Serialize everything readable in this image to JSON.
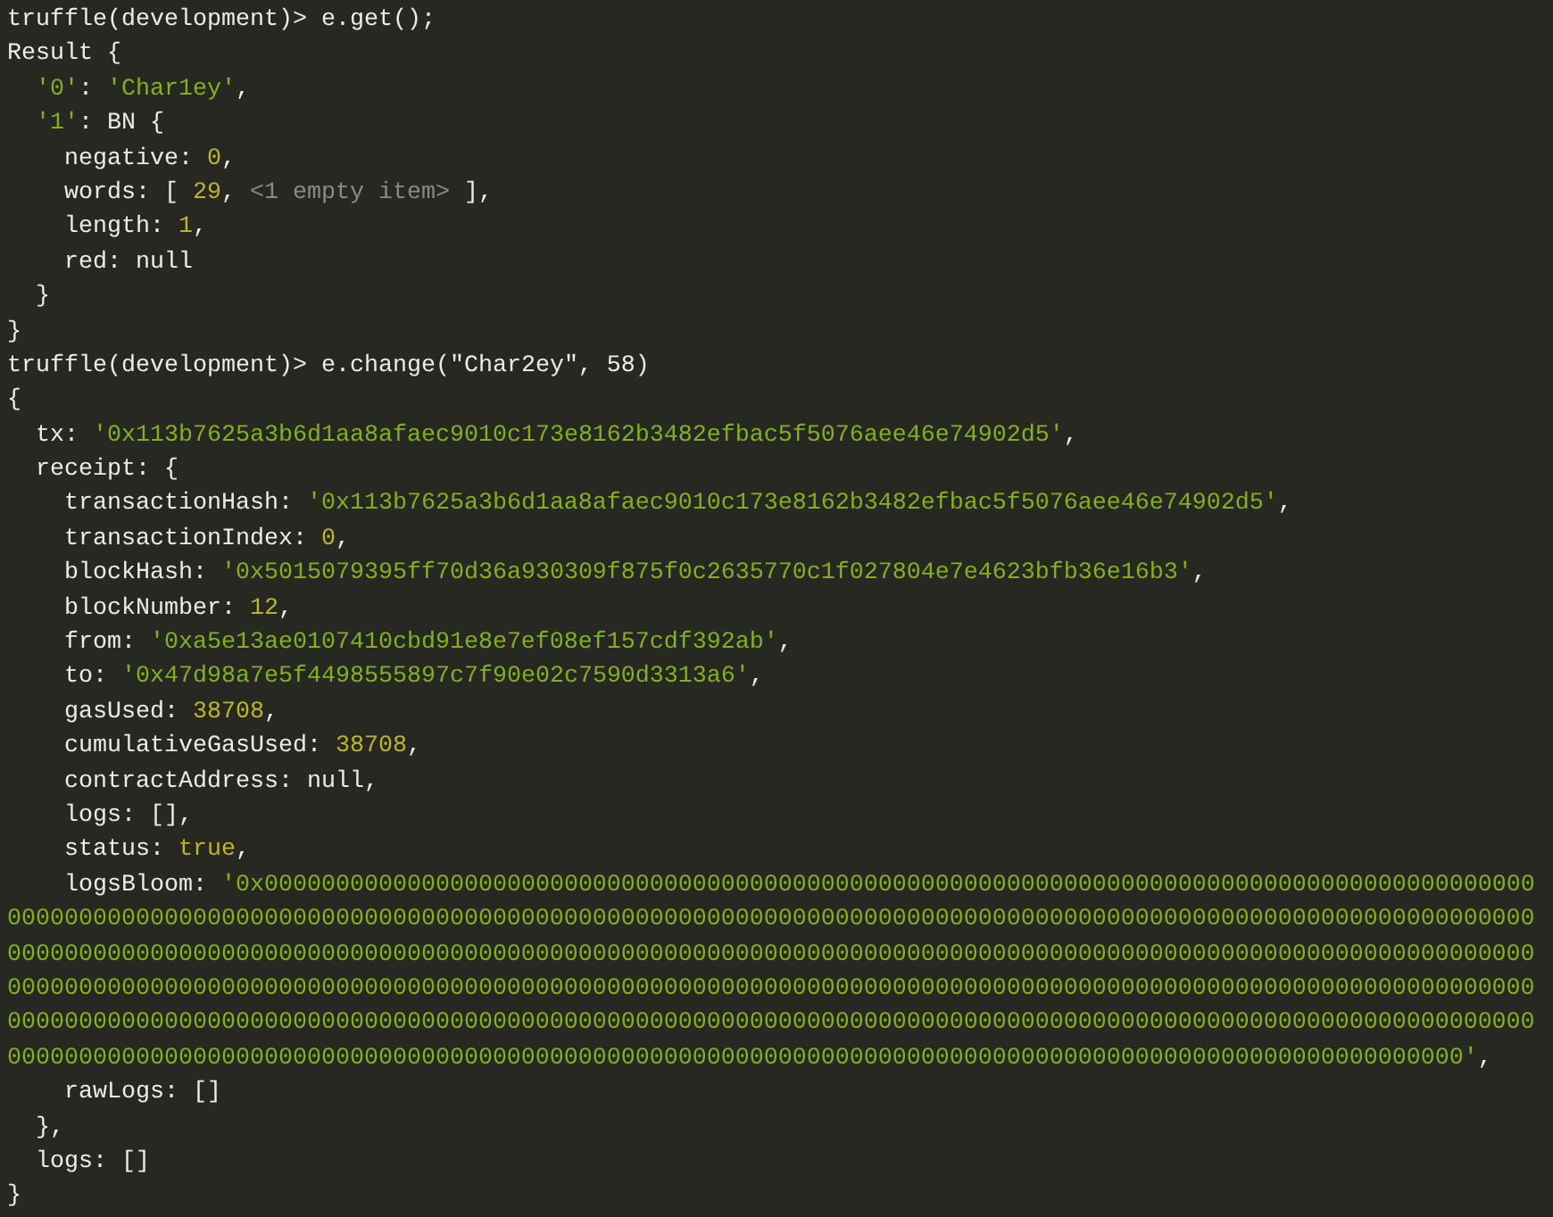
{
  "console_lines": [
    {
      "segments": [
        {
          "kind": "prompt",
          "text": "truffle(development)> "
        },
        {
          "kind": "plain",
          "text": "e.get();"
        }
      ]
    },
    {
      "segments": [
        {
          "kind": "plain",
          "text": "Result {"
        }
      ]
    },
    {
      "segments": [
        {
          "kind": "string",
          "text": "  '0'"
        },
        {
          "kind": "plain",
          "text": ": "
        },
        {
          "kind": "string",
          "text": "'Char1ey'"
        },
        {
          "kind": "plain",
          "text": ","
        }
      ]
    },
    {
      "segments": [
        {
          "kind": "string",
          "text": "  '1'"
        },
        {
          "kind": "plain",
          "text": ": BN {"
        }
      ]
    },
    {
      "segments": [
        {
          "kind": "plain",
          "text": "    negative: "
        },
        {
          "kind": "number",
          "text": "0"
        },
        {
          "kind": "plain",
          "text": ","
        }
      ]
    },
    {
      "segments": [
        {
          "kind": "plain",
          "text": "    words: [ "
        },
        {
          "kind": "number",
          "text": "29"
        },
        {
          "kind": "plain",
          "text": ", "
        },
        {
          "kind": "dim",
          "text": "<1 empty item>"
        },
        {
          "kind": "plain",
          "text": " ],"
        }
      ]
    },
    {
      "segments": [
        {
          "kind": "plain",
          "text": "    length: "
        },
        {
          "kind": "number",
          "text": "1"
        },
        {
          "kind": "plain",
          "text": ","
        }
      ]
    },
    {
      "segments": [
        {
          "kind": "plain",
          "text": "    red: null"
        }
      ]
    },
    {
      "segments": [
        {
          "kind": "plain",
          "text": "  }"
        }
      ]
    },
    {
      "segments": [
        {
          "kind": "plain",
          "text": "}"
        }
      ]
    },
    {
      "segments": [
        {
          "kind": "prompt",
          "text": "truffle(development)> "
        },
        {
          "kind": "plain",
          "text": "e.change(\"Char2ey\", 58)"
        }
      ]
    },
    {
      "segments": [
        {
          "kind": "plain",
          "text": "{"
        }
      ]
    },
    {
      "segments": [
        {
          "kind": "plain",
          "text": "  tx: "
        },
        {
          "kind": "string",
          "text": "'0x113b7625a3b6d1aa8afaec9010c173e8162b3482efbac5f5076aee46e74902d5'"
        },
        {
          "kind": "plain",
          "text": ","
        }
      ]
    },
    {
      "segments": [
        {
          "kind": "plain",
          "text": "  receipt: {"
        }
      ]
    },
    {
      "segments": [
        {
          "kind": "plain",
          "text": "    transactionHash: "
        },
        {
          "kind": "string",
          "text": "'0x113b7625a3b6d1aa8afaec9010c173e8162b3482efbac5f5076aee46e74902d5'"
        },
        {
          "kind": "plain",
          "text": ","
        }
      ]
    },
    {
      "segments": [
        {
          "kind": "plain",
          "text": "    transactionIndex: "
        },
        {
          "kind": "number",
          "text": "0"
        },
        {
          "kind": "plain",
          "text": ","
        }
      ]
    },
    {
      "segments": [
        {
          "kind": "plain",
          "text": "    blockHash: "
        },
        {
          "kind": "string",
          "text": "'0x5015079395ff70d36a930309f875f0c2635770c1f027804e7e4623bfb36e16b3'"
        },
        {
          "kind": "plain",
          "text": ","
        }
      ]
    },
    {
      "segments": [
        {
          "kind": "plain",
          "text": "    blockNumber: "
        },
        {
          "kind": "number",
          "text": "12"
        },
        {
          "kind": "plain",
          "text": ","
        }
      ]
    },
    {
      "segments": [
        {
          "kind": "plain",
          "text": "    from: "
        },
        {
          "kind": "string",
          "text": "'0xa5e13ae0107410cbd91e8e7ef08ef157cdf392ab'"
        },
        {
          "kind": "plain",
          "text": ","
        }
      ]
    },
    {
      "segments": [
        {
          "kind": "plain",
          "text": "    to: "
        },
        {
          "kind": "string",
          "text": "'0x47d98a7e5f4498555897c7f90e02c7590d3313a6'"
        },
        {
          "kind": "plain",
          "text": ","
        }
      ]
    },
    {
      "segments": [
        {
          "kind": "plain",
          "text": "    gasUsed: "
        },
        {
          "kind": "number",
          "text": "38708"
        },
        {
          "kind": "plain",
          "text": ","
        }
      ]
    },
    {
      "segments": [
        {
          "kind": "plain",
          "text": "    cumulativeGasUsed: "
        },
        {
          "kind": "number",
          "text": "38708"
        },
        {
          "kind": "plain",
          "text": ","
        }
      ]
    },
    {
      "segments": [
        {
          "kind": "plain",
          "text": "    contractAddress: null,"
        }
      ]
    },
    {
      "segments": [
        {
          "kind": "plain",
          "text": "    logs: [],"
        }
      ]
    },
    {
      "segments": [
        {
          "kind": "plain",
          "text": "    status: "
        },
        {
          "kind": "number",
          "text": "true"
        },
        {
          "kind": "plain",
          "text": ","
        }
      ]
    },
    {
      "segments": [
        {
          "kind": "plain",
          "text": "    logsBloom: "
        },
        {
          "kind": "string",
          "text": "'0x00000000000000000000000000000000000000000000000000000000000000000000000000000000000000000"
        }
      ]
    },
    {
      "segments": [
        {
          "kind": "string",
          "text": "00000000000000000000000000000000000000000000000000000000000000000000000000000000000000000000000000000000000"
        }
      ]
    },
    {
      "segments": [
        {
          "kind": "string",
          "text": "00000000000000000000000000000000000000000000000000000000000000000000000000000000000000000000000000000000000"
        }
      ]
    },
    {
      "segments": [
        {
          "kind": "string",
          "text": "00000000000000000000000000000000000000000000000000000000000000000000000000000000000000000000000000000000000"
        }
      ]
    },
    {
      "segments": [
        {
          "kind": "string",
          "text": "00000000000000000000000000000000000000000000000000000000000000000000000000000000000000000000000000000000000"
        }
      ]
    },
    {
      "segments": [
        {
          "kind": "string",
          "text": "000000000000000000000000000000000000000000000000000000000000000000000000000000000000000000000000000000'"
        },
        {
          "kind": "plain",
          "text": ","
        }
      ]
    },
    {
      "segments": [
        {
          "kind": "plain",
          "text": "    rawLogs: []"
        }
      ]
    },
    {
      "segments": [
        {
          "kind": "plain",
          "text": "  },"
        }
      ]
    },
    {
      "segments": [
        {
          "kind": "plain",
          "text": "  logs: []"
        }
      ]
    },
    {
      "segments": [
        {
          "kind": "plain",
          "text": "}"
        }
      ]
    }
  ]
}
